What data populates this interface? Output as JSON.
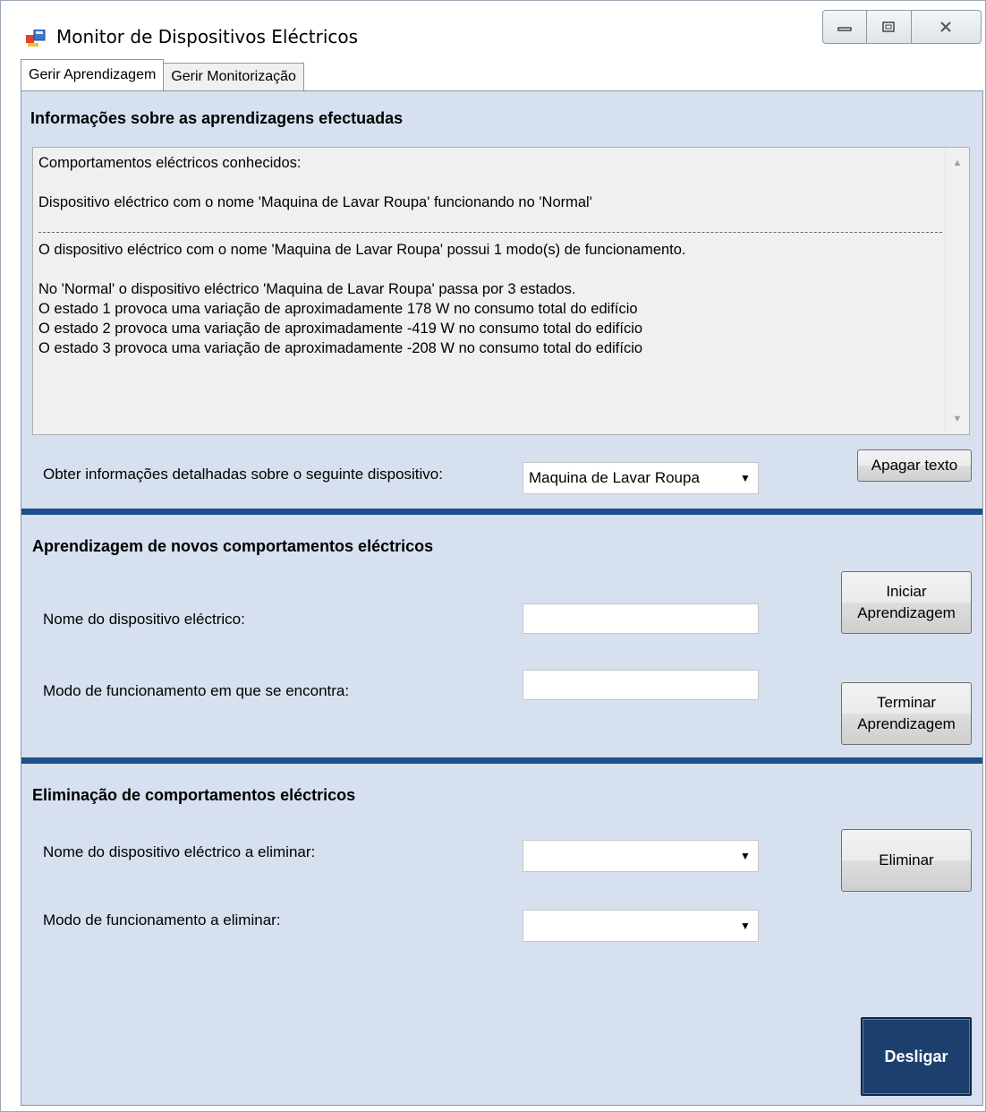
{
  "window": {
    "title": "Monitor de Dispositivos Eléctricos",
    "controls": {
      "minimize": "—",
      "maximize": "▢",
      "close": "✕"
    }
  },
  "tabs": [
    {
      "label": "Gerir Aprendizagem",
      "active": true
    },
    {
      "label": "Gerir Monitorização",
      "active": false
    }
  ],
  "info_section": {
    "title": "Informações sobre as aprendizagens efectuadas",
    "lines": [
      "Comportamentos eléctricos conhecidos:",
      "Dispositivo eléctrico com o nome 'Maquina de Lavar Roupa' funcionando no 'Normal'",
      "O dispositivo eléctrico com o nome 'Maquina de Lavar Roupa' possui 1 modo(s) de funcionamento.",
      "No 'Normal' o dispositivo eléctrico 'Maquina de Lavar Roupa' passa por 3 estados.",
      "O estado 1 provoca uma variação de aproximadamente 178 W no consumo total do edifício",
      "O estado 2 provoca uma variação de aproximadamente -419 W no consumo total do edifício",
      "O estado 3 provoca uma variação de aproximadamente -208 W no consumo total do edifício"
    ],
    "details_label": "Obter informações detalhadas sobre o seguinte dispositivo:",
    "details_selected": "Maquina de Lavar Roupa",
    "clear_button": "Apagar texto"
  },
  "learn_section": {
    "title": "Aprendizagem de novos comportamentos eléctricos",
    "device_name_label": "Nome do dispositivo eléctrico:",
    "device_name_value": "",
    "mode_label": "Modo de funcionamento em que se encontra:",
    "mode_value": "",
    "start_button_line1": "Iniciar",
    "start_button_line2": "Aprendizagem",
    "stop_button_line1": "Terminar",
    "stop_button_line2": "Aprendizagem"
  },
  "delete_section": {
    "title": "Eliminação de comportamentos eléctricos",
    "device_label": "Nome do dispositivo eléctrico a eliminar:",
    "device_selected": "",
    "mode_label": "Modo de funcionamento a eliminar:",
    "mode_selected": "",
    "delete_button": "Eliminar"
  },
  "shutdown_button": "Desligar",
  "colors": {
    "panel_bg": "#d6e0ef",
    "divider": "#1f4e8c",
    "shutdown_bg": "#1c3f6e"
  }
}
